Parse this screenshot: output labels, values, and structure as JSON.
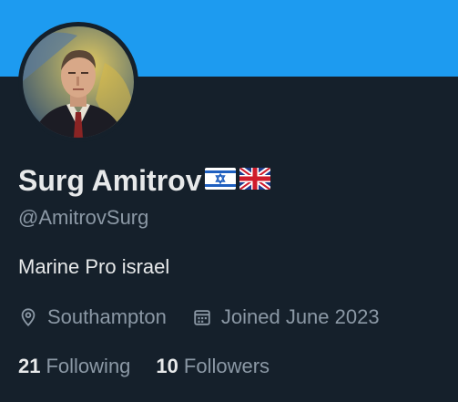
{
  "profile": {
    "display_name": "Surg Amitrov",
    "name_flags": [
      "flag-israel-icon",
      "flag-united-kingdom-icon"
    ],
    "handle": "@AmitrovSurg",
    "bio": "Marine Pro israel",
    "location": "Southampton",
    "joined": "Joined June 2023"
  },
  "stats": {
    "following_count": "21",
    "following_label": "Following",
    "followers_count": "10",
    "followers_label": "Followers"
  },
  "colors": {
    "banner": "#1d9bf0",
    "background": "#15202b",
    "primary_text": "#e7e9ea",
    "secondary_text": "#8b98a5"
  }
}
